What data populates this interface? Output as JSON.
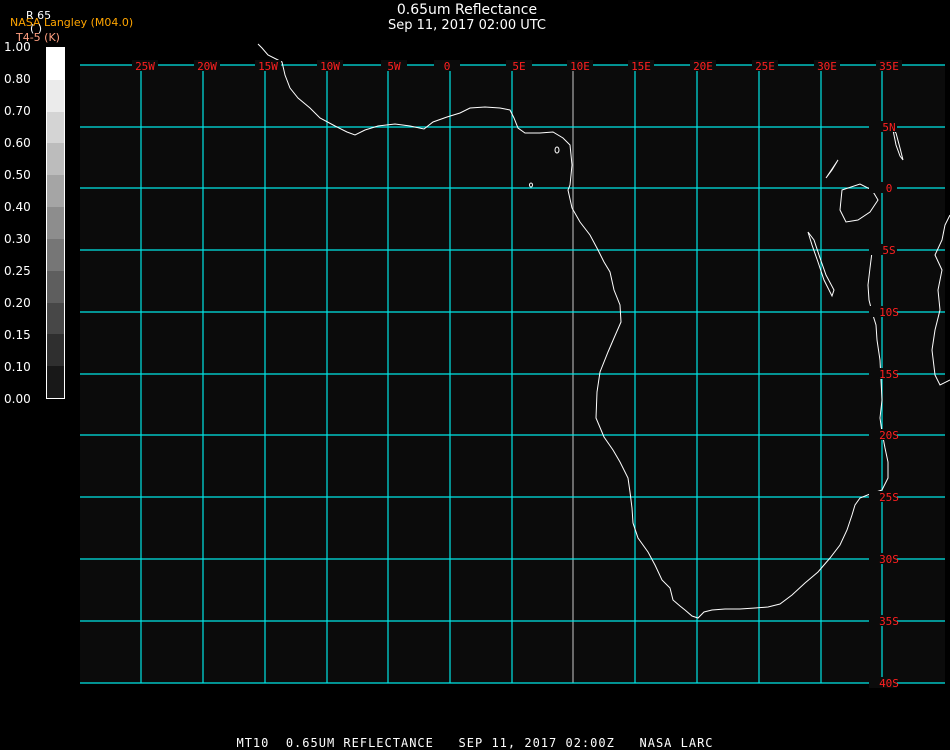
{
  "header": {
    "title": "0.65um Reflectance",
    "subtitle": "Sep 11, 2017 02:00 UTC"
  },
  "overlay": {
    "product_code": "R 65",
    "units_paren": "(  )",
    "source": "NASA Langley (M04.0)",
    "secondary": "T4-5 (K)"
  },
  "colorbar": {
    "labels": [
      "1.00",
      "0.80",
      "0.70",
      "0.60",
      "0.50",
      "0.40",
      "0.30",
      "0.25",
      "0.20",
      "0.15",
      "0.10",
      "0.00"
    ],
    "range": [
      0.0,
      1.0
    ],
    "colors": [
      "#ffffff",
      "#000000"
    ]
  },
  "map": {
    "background": "#0b0b0b",
    "grid_color": "#00e5e5",
    "coastline_color": "#ffffff",
    "label_color": "#ff2020",
    "longitude_labels": [
      "25W",
      "20W",
      "15W",
      "10W",
      "5W",
      "0",
      "5E",
      "10E",
      "15E",
      "20E",
      "25E",
      "30E",
      "35E"
    ],
    "latitude_labels": [
      "5N",
      "0",
      "5S",
      "10S",
      "15S",
      "20S",
      "25S",
      "30S",
      "35S",
      "40S"
    ]
  },
  "footer": {
    "text": "MT10  0.65UM REFLECTANCE   SEP 11, 2017 02:00Z   NASA LARC"
  }
}
